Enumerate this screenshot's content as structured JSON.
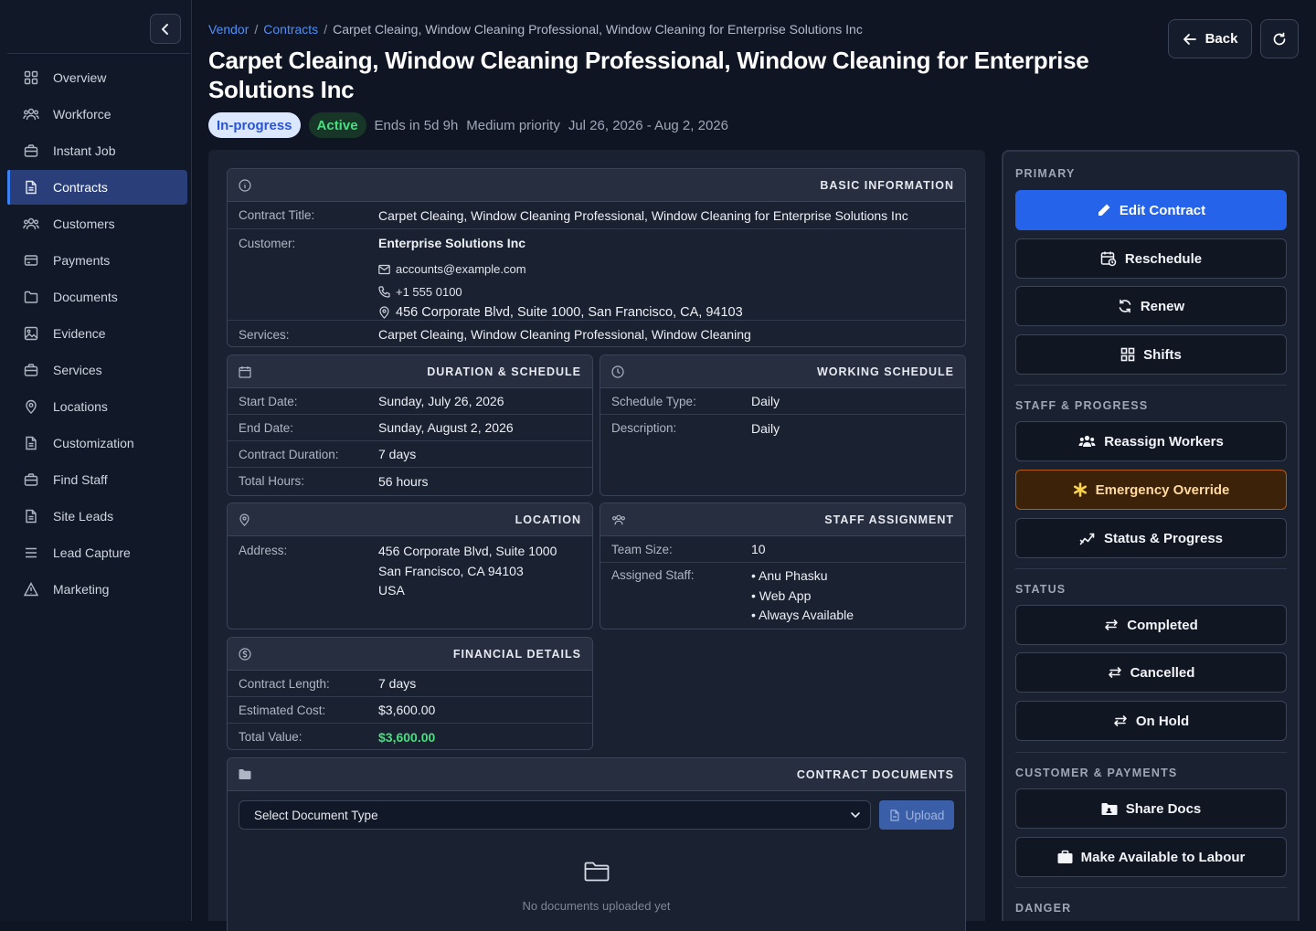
{
  "sidebar": {
    "items": [
      {
        "label": "Overview",
        "icon": "grid-icon"
      },
      {
        "label": "Workforce",
        "icon": "users-icon"
      },
      {
        "label": "Instant Job",
        "icon": "briefcase-icon"
      },
      {
        "label": "Contracts",
        "icon": "document-icon",
        "active": true
      },
      {
        "label": "Customers",
        "icon": "users-icon"
      },
      {
        "label": "Payments",
        "icon": "card-icon"
      },
      {
        "label": "Documents",
        "icon": "folder-icon"
      },
      {
        "label": "Evidence",
        "icon": "image-icon"
      },
      {
        "label": "Services",
        "icon": "briefcase-icon"
      },
      {
        "label": "Locations",
        "icon": "pin-icon"
      },
      {
        "label": "Customization",
        "icon": "document-icon"
      },
      {
        "label": "Find Staff",
        "icon": "briefcase-icon"
      },
      {
        "label": "Site Leads",
        "icon": "document-icon"
      },
      {
        "label": "Lead Capture",
        "icon": "menu-icon"
      },
      {
        "label": "Marketing",
        "icon": "warning-icon"
      }
    ]
  },
  "breadcrumb": {
    "vendor": "Vendor",
    "contracts": "Contracts",
    "sep": "/",
    "current": "Carpet Cleaing, Window Cleaning Professional, Window Cleaning for Enterprise Solutions Inc"
  },
  "page": {
    "title": "Carpet Cleaing, Window Cleaning Professional, Window Cleaning for Enterprise Solutions Inc",
    "status_badge": "In-progress",
    "active_badge": "Active",
    "ends_in": "Ends in 5d 9h",
    "priority": "Medium priority",
    "date_range": "Jul 26, 2026 - Aug 2, 2026",
    "back_label": "Back"
  },
  "basic_info": {
    "heading": "BASIC INFORMATION",
    "contract_title_label": "Contract Title:",
    "contract_title": "Carpet Cleaing, Window Cleaning Professional, Window Cleaning for Enterprise Solutions Inc",
    "customer_label": "Customer:",
    "customer_name": "Enterprise Solutions Inc",
    "email": "accounts@example.com",
    "phone": "+1 555 0100",
    "address": "456 Corporate Blvd, Suite 1000, San Francisco, CA, 94103",
    "services_label": "Services:",
    "services": "Carpet Cleaing, Window Cleaning Professional, Window Cleaning"
  },
  "duration": {
    "heading": "DURATION & SCHEDULE",
    "rows": [
      {
        "label": "Start Date:",
        "value": "Sunday, July 26, 2026"
      },
      {
        "label": "End Date:",
        "value": "Sunday, August 2, 2026"
      },
      {
        "label": "Contract Duration:",
        "value": "7 days"
      },
      {
        "label": "Total Hours:",
        "value": "56 hours"
      }
    ]
  },
  "working": {
    "heading": "WORKING SCHEDULE",
    "rows": [
      {
        "label": "Schedule Type:",
        "value": "Daily"
      },
      {
        "label": "Description:",
        "value": "Daily"
      }
    ]
  },
  "location": {
    "heading": "LOCATION",
    "label": "Address:",
    "line1": "456 Corporate Blvd, Suite 1000",
    "line2": "San Francisco, CA 94103",
    "line3": "USA"
  },
  "staff": {
    "heading": "STAFF ASSIGNMENT",
    "team_label": "Team Size:",
    "team_size": "10",
    "assigned_label": "Assigned Staff:",
    "members": [
      "• Anu Phasku",
      "• Web App",
      "• Always Available"
    ]
  },
  "financial": {
    "heading": "FINANCIAL DETAILS",
    "rows": [
      {
        "label": "Contract Length:",
        "value": "7 days"
      },
      {
        "label": "Estimated Cost:",
        "value": "$3,600.00"
      },
      {
        "label": "Total Value:",
        "value": "$3,600.00"
      }
    ],
    "total_color": "#4ade80"
  },
  "documents": {
    "heading": "CONTRACT DOCUMENTS",
    "select_placeholder": "Select Document Type",
    "upload_label": "Upload",
    "empty_text": "No documents uploaded yet"
  },
  "actions": {
    "primary_title": "PRIMARY",
    "edit": "Edit Contract",
    "reschedule": "Reschedule",
    "renew": "Renew",
    "shifts": "Shifts",
    "staff_title": "STAFF & PROGRESS",
    "reassign": "Reassign Workers",
    "emergency": "Emergency Override",
    "status_progress": "Status & Progress",
    "status_title": "STATUS",
    "completed": "Completed",
    "cancelled": "Cancelled",
    "on_hold": "On Hold",
    "customer_title": "CUSTOMER & PAYMENTS",
    "share_docs": "Share Docs",
    "make_available": "Make Available to Labour",
    "danger_title": "DANGER"
  },
  "colors": {
    "accent": "#2563eb",
    "link": "#4f8ff7",
    "warning": "#b45a14"
  }
}
